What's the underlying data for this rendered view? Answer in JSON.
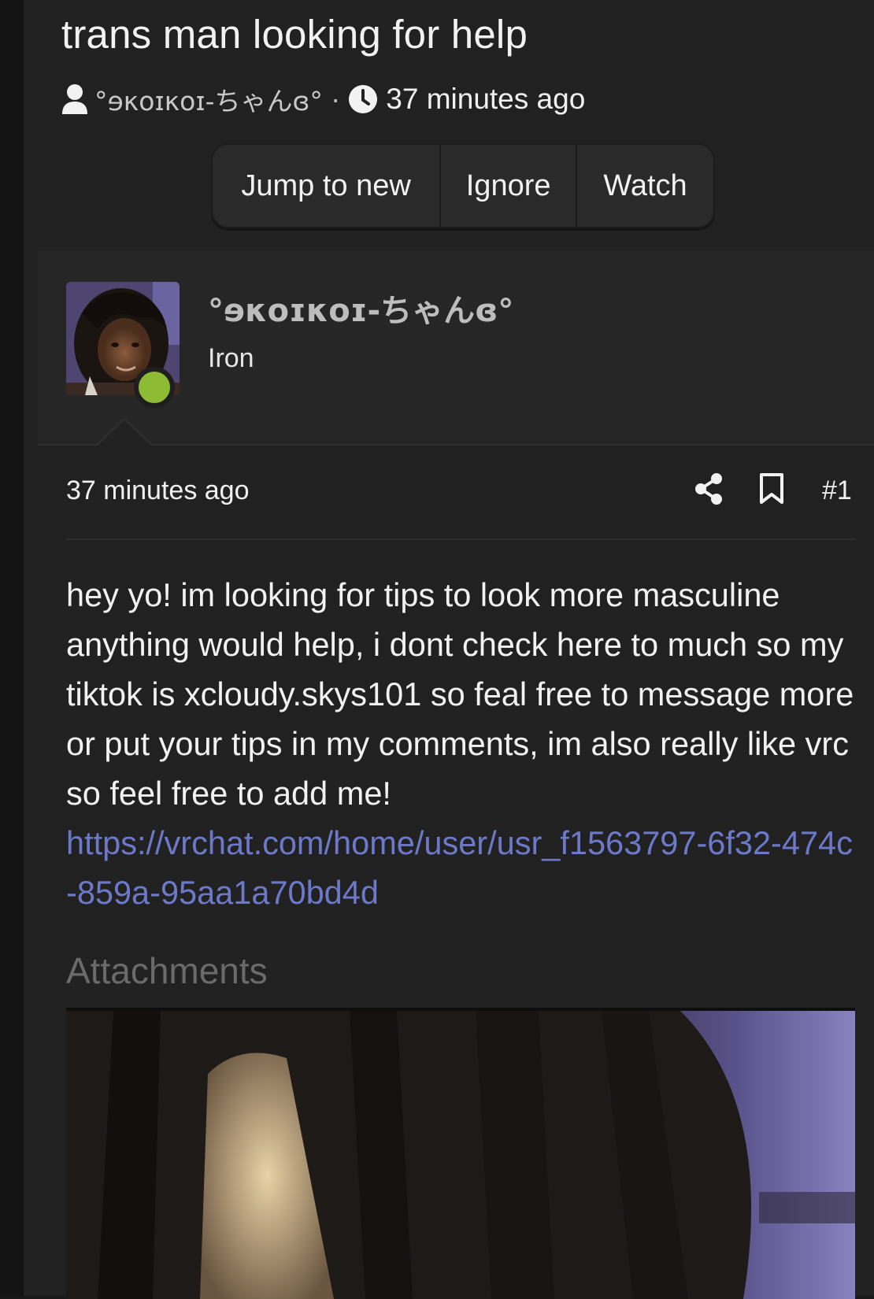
{
  "thread": {
    "title": "trans man looking for help",
    "author": "°ɘκοɪκοɪ-ちゃんɞ°",
    "separator": "·",
    "time": "37 minutes ago"
  },
  "actions": {
    "jump_label": "Jump to new",
    "ignore_label": "Ignore",
    "watch_label": "Watch"
  },
  "user": {
    "name": "°ɘκοɪκοɪ-ちゃんɞ°",
    "title": "Iron",
    "online": true,
    "status_color": "#8dbb34"
  },
  "post": {
    "time": "37 minutes ago",
    "number": "#1",
    "body": "hey yo! im looking for tips to look more masculine anything would help, i dont check here to much so my tiktok is xcloudy.skys101 so feal free to message more or put your tips in my comments, im also really like vrc so feel free to add me!",
    "link": "https://vrchat.com/home/user/usr_f1563797-6f32-474c-859a-95aa1a70bd4d",
    "link_color": "#6c79c9"
  },
  "attachments": {
    "label": "Attachments"
  },
  "icons": [
    "user-icon",
    "clock-icon",
    "share-icon",
    "bookmark-icon"
  ]
}
